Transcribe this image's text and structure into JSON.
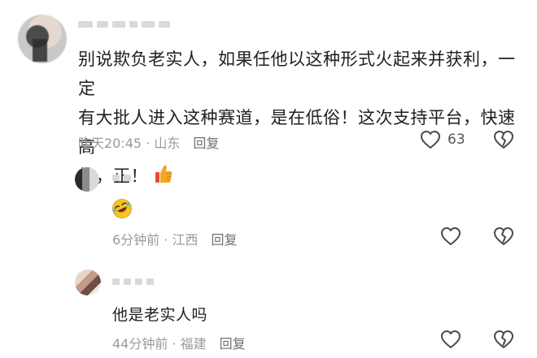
{
  "comments": {
    "main": {
      "text_lines": [
        "别说欺负老实人，如果任他以这种形式火起来并获利，一定",
        "有大批人进入这种赛道，是在低俗！这次支持平台，快速高",
        "效，正！"
      ],
      "emoji": "thumbs-up",
      "time_location": "昨天20:45 · 山东",
      "reply_label": "回复",
      "like_count": "63"
    },
    "reply1": {
      "emoji": "rolling-on-floor-laughing",
      "time_location": "6分钟前 · 江西",
      "reply_label": "回复"
    },
    "reply2": {
      "text": "他是老实人吗",
      "time_location": "44分钟前 · 福建",
      "reply_label": "回复"
    }
  },
  "colors": {
    "text": "#1f1f1f",
    "meta": "#9a9a9a",
    "icon": "#4a4a4a",
    "thumbs": "#f5a623",
    "thumbs_cuff": "#e8453c",
    "laugh": "#f7c325"
  }
}
